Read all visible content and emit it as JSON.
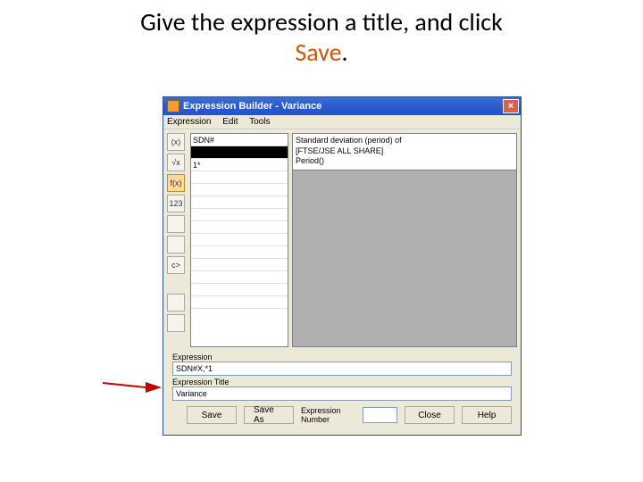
{
  "heading": {
    "line1": "Give the expression a title, and click",
    "accent": "Save",
    "period": "."
  },
  "window": {
    "title": "Expression Builder - Variance",
    "close_glyph": "×",
    "menus": [
      "Expression",
      "Edit",
      "Tools"
    ],
    "tools": [
      {
        "label": "(x)",
        "name": "tool-paren"
      },
      {
        "label": "√x",
        "name": "tool-sqrt"
      },
      {
        "label": "f(x)",
        "name": "tool-fn",
        "selected": true
      },
      {
        "label": "123",
        "name": "tool-num"
      },
      {
        "label": "",
        "name": "tool-5"
      },
      {
        "label": "",
        "name": "tool-6"
      },
      {
        "label": "c>",
        "name": "tool-c"
      },
      {
        "label": "",
        "name": "tool-8"
      },
      {
        "label": "",
        "name": "tool-9"
      }
    ],
    "list": {
      "row0": "SDN#",
      "row1": "",
      "row2": "1*"
    },
    "preview": {
      "line0": "Standard deviation (period) of",
      "line1": "[FTSE/JSE ALL SHARE]",
      "line2": "Period()"
    },
    "fields": {
      "expression_label": "Expression",
      "expression_value": "SDN#X,*1",
      "title_label": "Expression Title",
      "title_value": "Variance"
    },
    "buttons": {
      "save": "Save",
      "saveas": "Save As",
      "exprnum_label": "Expression Number",
      "close": "Close",
      "help": "Help"
    }
  }
}
